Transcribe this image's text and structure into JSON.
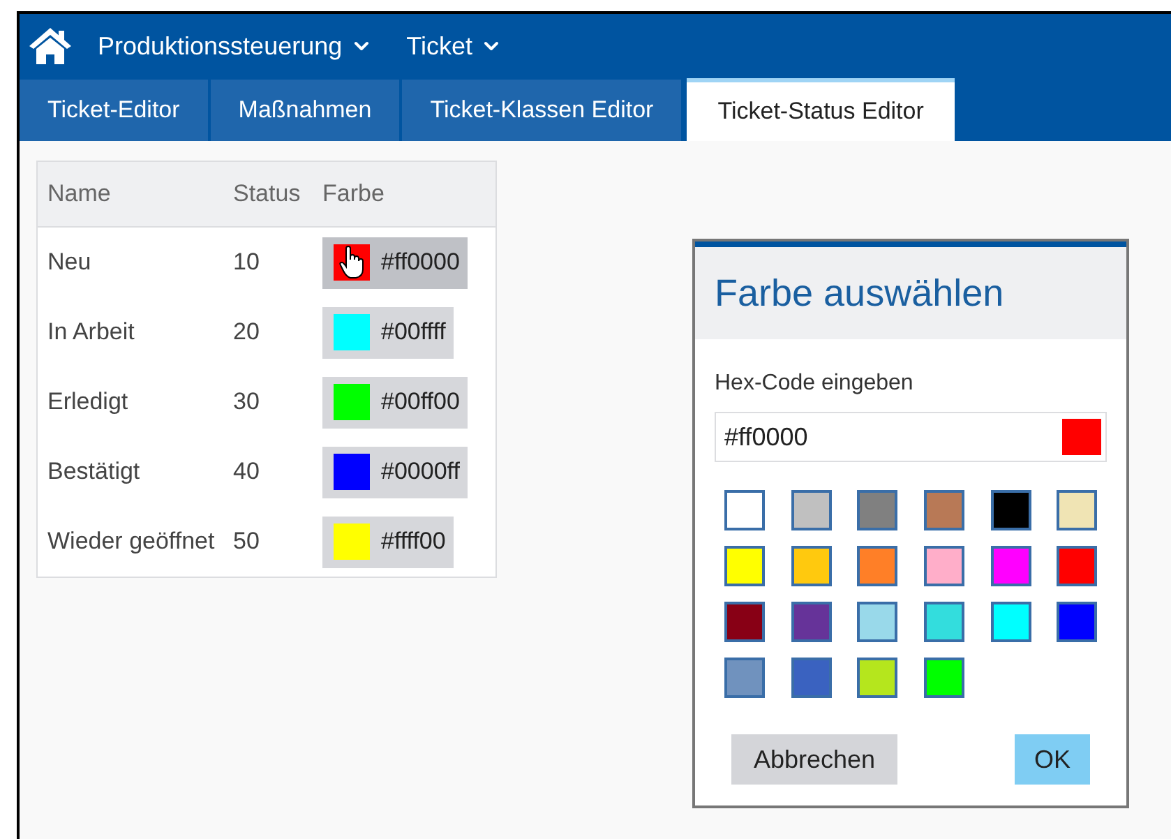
{
  "nav": {
    "items": [
      {
        "label": "Produktionssteuerung"
      },
      {
        "label": "Ticket"
      }
    ]
  },
  "tabs": [
    {
      "label": "Ticket-Editor",
      "selected": false
    },
    {
      "label": "Maßnahmen",
      "selected": false
    },
    {
      "label": "Ticket-Klassen Editor",
      "selected": false
    },
    {
      "label": "Ticket-Status Editor",
      "selected": true
    }
  ],
  "table": {
    "columns": [
      "Name",
      "Status",
      "Farbe"
    ],
    "rows": [
      {
        "name": "Neu",
        "status": "10",
        "hex": "#ff0000",
        "color": "#ff0000",
        "hovered": true
      },
      {
        "name": "In Arbeit",
        "status": "20",
        "hex": "#00ffff",
        "color": "#00ffff",
        "hovered": false
      },
      {
        "name": "Erledigt",
        "status": "30",
        "hex": "#00ff00",
        "color": "#00ff00",
        "hovered": false
      },
      {
        "name": "Bestätigt",
        "status": "40",
        "hex": "#0000ff",
        "color": "#0000ff",
        "hovered": false
      },
      {
        "name": "Wieder geöffnet",
        "status": "50",
        "hex": "#ffff00",
        "color": "#ffff00",
        "hovered": false
      }
    ]
  },
  "dialog": {
    "title": "Farbe auswählen",
    "label": "Hex-Code eingeben",
    "value": "#ff0000",
    "preview": {
      "color": "#ff0000"
    },
    "swatches": [
      {
        "color": "#ffffff"
      },
      {
        "color": "#c0c0c0"
      },
      {
        "color": "#808080"
      },
      {
        "color": "#b87956"
      },
      {
        "color": "#000000"
      },
      {
        "color": "#f0e4b4"
      },
      {
        "color": "#ffff00"
      },
      {
        "color": "#ffc90e"
      },
      {
        "color": "#ff7f27"
      },
      {
        "color": "#ffaec9"
      },
      {
        "color": "#ff00ff"
      },
      {
        "color": "#ff0000"
      },
      {
        "color": "#880015"
      },
      {
        "color": "#663399"
      },
      {
        "color": "#99d9ea"
      },
      {
        "color": "#33dddd"
      },
      {
        "color": "#00ffff"
      },
      {
        "color": "#0000ff"
      },
      {
        "color": "#7092be"
      },
      {
        "color": "#3a62c0"
      },
      {
        "color": "#b5e61d"
      },
      {
        "color": "#00ff00"
      }
    ],
    "buttons": [
      {
        "label": "Abbrechen",
        "kind": "secondary"
      },
      {
        "label": "OK",
        "kind": "primary"
      }
    ]
  }
}
